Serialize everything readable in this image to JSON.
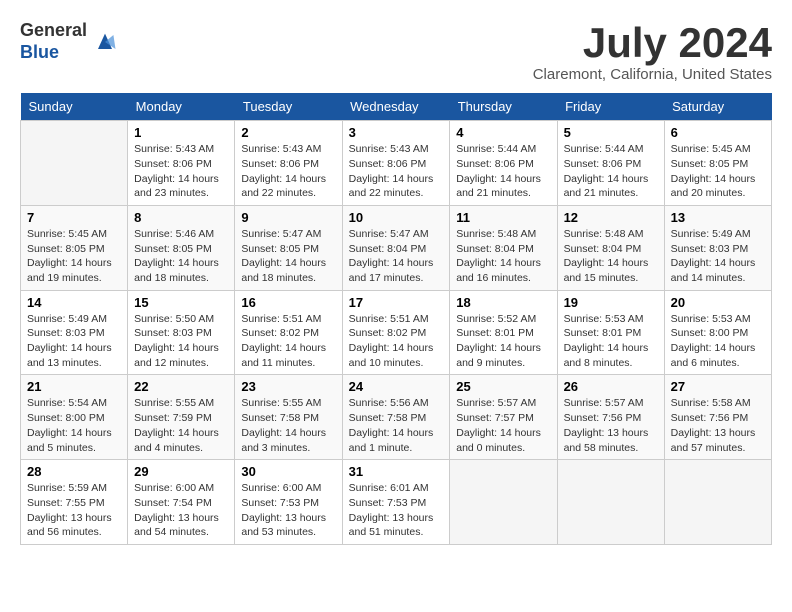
{
  "header": {
    "logo_general": "General",
    "logo_blue": "Blue",
    "month": "July 2024",
    "location": "Claremont, California, United States"
  },
  "days_of_week": [
    "Sunday",
    "Monday",
    "Tuesday",
    "Wednesday",
    "Thursday",
    "Friday",
    "Saturday"
  ],
  "weeks": [
    [
      {
        "day": "",
        "info": ""
      },
      {
        "day": "1",
        "info": "Sunrise: 5:43 AM\nSunset: 8:06 PM\nDaylight: 14 hours\nand 23 minutes."
      },
      {
        "day": "2",
        "info": "Sunrise: 5:43 AM\nSunset: 8:06 PM\nDaylight: 14 hours\nand 22 minutes."
      },
      {
        "day": "3",
        "info": "Sunrise: 5:43 AM\nSunset: 8:06 PM\nDaylight: 14 hours\nand 22 minutes."
      },
      {
        "day": "4",
        "info": "Sunrise: 5:44 AM\nSunset: 8:06 PM\nDaylight: 14 hours\nand 21 minutes."
      },
      {
        "day": "5",
        "info": "Sunrise: 5:44 AM\nSunset: 8:06 PM\nDaylight: 14 hours\nand 21 minutes."
      },
      {
        "day": "6",
        "info": "Sunrise: 5:45 AM\nSunset: 8:05 PM\nDaylight: 14 hours\nand 20 minutes."
      }
    ],
    [
      {
        "day": "7",
        "info": "Sunrise: 5:45 AM\nSunset: 8:05 PM\nDaylight: 14 hours\nand 19 minutes."
      },
      {
        "day": "8",
        "info": "Sunrise: 5:46 AM\nSunset: 8:05 PM\nDaylight: 14 hours\nand 18 minutes."
      },
      {
        "day": "9",
        "info": "Sunrise: 5:47 AM\nSunset: 8:05 PM\nDaylight: 14 hours\nand 18 minutes."
      },
      {
        "day": "10",
        "info": "Sunrise: 5:47 AM\nSunset: 8:04 PM\nDaylight: 14 hours\nand 17 minutes."
      },
      {
        "day": "11",
        "info": "Sunrise: 5:48 AM\nSunset: 8:04 PM\nDaylight: 14 hours\nand 16 minutes."
      },
      {
        "day": "12",
        "info": "Sunrise: 5:48 AM\nSunset: 8:04 PM\nDaylight: 14 hours\nand 15 minutes."
      },
      {
        "day": "13",
        "info": "Sunrise: 5:49 AM\nSunset: 8:03 PM\nDaylight: 14 hours\nand 14 minutes."
      }
    ],
    [
      {
        "day": "14",
        "info": "Sunrise: 5:49 AM\nSunset: 8:03 PM\nDaylight: 14 hours\nand 13 minutes."
      },
      {
        "day": "15",
        "info": "Sunrise: 5:50 AM\nSunset: 8:03 PM\nDaylight: 14 hours\nand 12 minutes."
      },
      {
        "day": "16",
        "info": "Sunrise: 5:51 AM\nSunset: 8:02 PM\nDaylight: 14 hours\nand 11 minutes."
      },
      {
        "day": "17",
        "info": "Sunrise: 5:51 AM\nSunset: 8:02 PM\nDaylight: 14 hours\nand 10 minutes."
      },
      {
        "day": "18",
        "info": "Sunrise: 5:52 AM\nSunset: 8:01 PM\nDaylight: 14 hours\nand 9 minutes."
      },
      {
        "day": "19",
        "info": "Sunrise: 5:53 AM\nSunset: 8:01 PM\nDaylight: 14 hours\nand 8 minutes."
      },
      {
        "day": "20",
        "info": "Sunrise: 5:53 AM\nSunset: 8:00 PM\nDaylight: 14 hours\nand 6 minutes."
      }
    ],
    [
      {
        "day": "21",
        "info": "Sunrise: 5:54 AM\nSunset: 8:00 PM\nDaylight: 14 hours\nand 5 minutes."
      },
      {
        "day": "22",
        "info": "Sunrise: 5:55 AM\nSunset: 7:59 PM\nDaylight: 14 hours\nand 4 minutes."
      },
      {
        "day": "23",
        "info": "Sunrise: 5:55 AM\nSunset: 7:58 PM\nDaylight: 14 hours\nand 3 minutes."
      },
      {
        "day": "24",
        "info": "Sunrise: 5:56 AM\nSunset: 7:58 PM\nDaylight: 14 hours\nand 1 minute."
      },
      {
        "day": "25",
        "info": "Sunrise: 5:57 AM\nSunset: 7:57 PM\nDaylight: 14 hours\nand 0 minutes."
      },
      {
        "day": "26",
        "info": "Sunrise: 5:57 AM\nSunset: 7:56 PM\nDaylight: 13 hours\nand 58 minutes."
      },
      {
        "day": "27",
        "info": "Sunrise: 5:58 AM\nSunset: 7:56 PM\nDaylight: 13 hours\nand 57 minutes."
      }
    ],
    [
      {
        "day": "28",
        "info": "Sunrise: 5:59 AM\nSunset: 7:55 PM\nDaylight: 13 hours\nand 56 minutes."
      },
      {
        "day": "29",
        "info": "Sunrise: 6:00 AM\nSunset: 7:54 PM\nDaylight: 13 hours\nand 54 minutes."
      },
      {
        "day": "30",
        "info": "Sunrise: 6:00 AM\nSunset: 7:53 PM\nDaylight: 13 hours\nand 53 minutes."
      },
      {
        "day": "31",
        "info": "Sunrise: 6:01 AM\nSunset: 7:53 PM\nDaylight: 13 hours\nand 51 minutes."
      },
      {
        "day": "",
        "info": ""
      },
      {
        "day": "",
        "info": ""
      },
      {
        "day": "",
        "info": ""
      }
    ]
  ]
}
